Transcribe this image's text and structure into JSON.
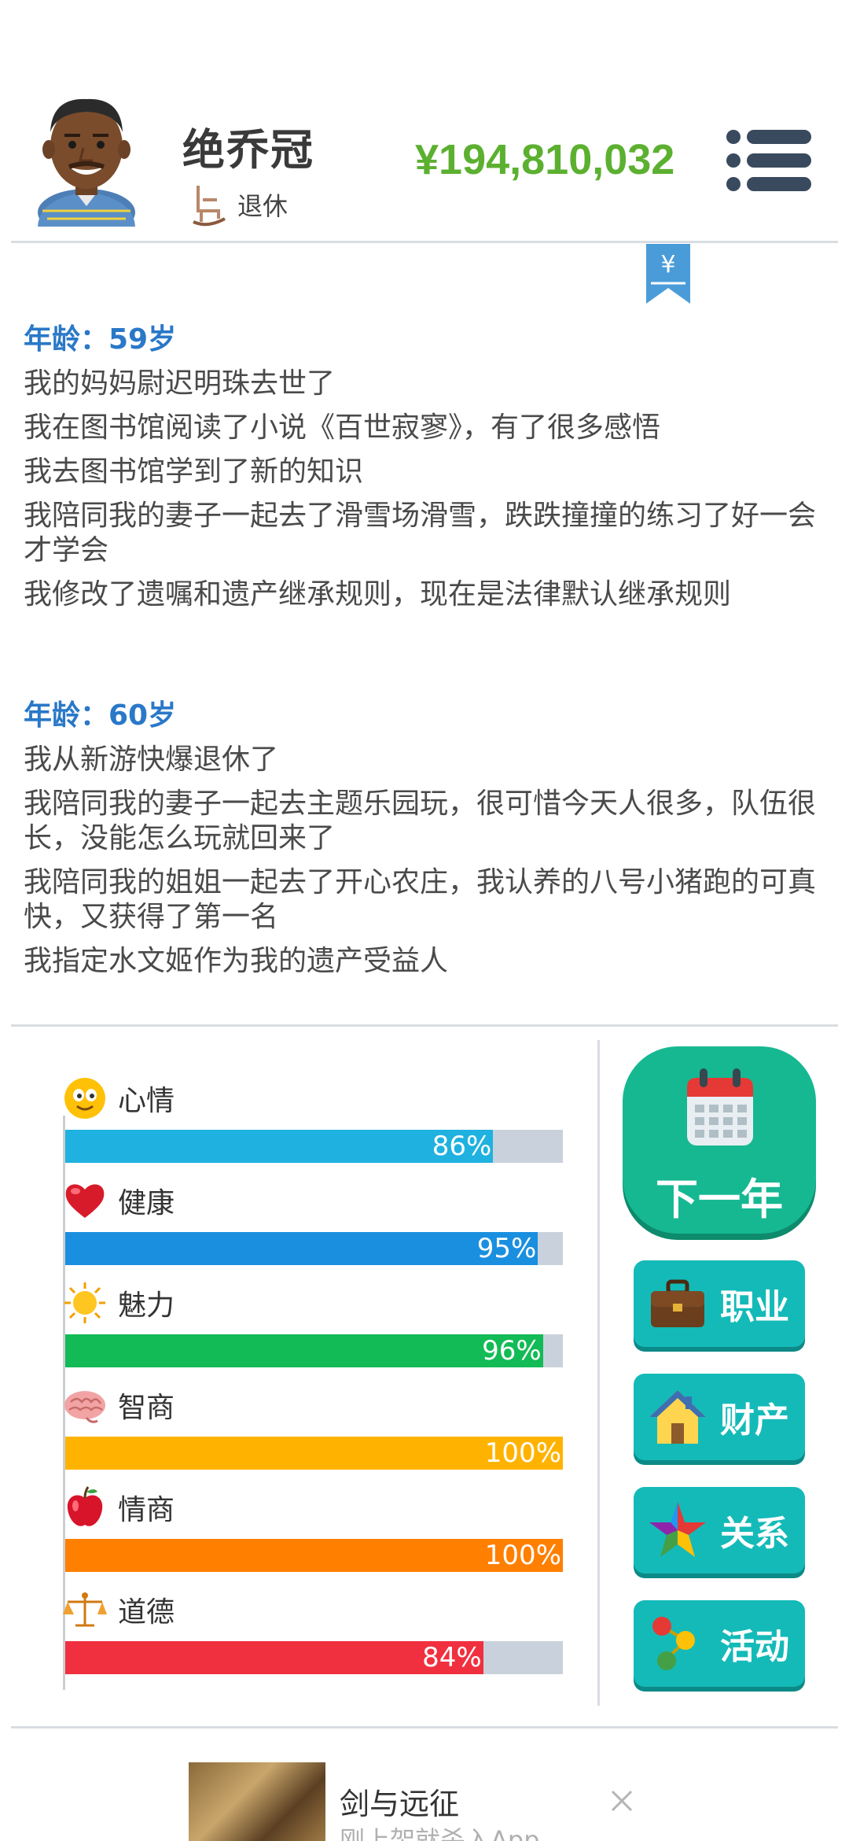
{
  "header": {
    "name": "绝乔冠",
    "status": "退休",
    "money": "¥194,810,032",
    "bookmark_symbol": "¥"
  },
  "log": [
    {
      "age_title": "年龄：59岁",
      "entries": [
        "我的妈妈尉迟明珠去世了",
        "我在图书馆阅读了小说《百世寂寥》，有了很多感悟",
        "我去图书馆学到了新的知识",
        "我陪同我的妻子一起去了滑雪场滑雪，跌跌撞撞的练习了好一会才学会",
        "我修改了遗嘱和遗产继承规则，现在是法律默认继承规则"
      ]
    },
    {
      "age_title": "年龄：60岁",
      "entries": [
        "我从新游快爆退休了",
        "我陪同我的妻子一起去主题乐园玩，很可惜今天人很多，队伍很长，没能怎么玩就回来了",
        "我陪同我的姐姐一起去了开心农庄，我认养的八号小猪跑的可真快，又获得了第一名",
        "我指定水文姬作为我的遗产受益人"
      ]
    }
  ],
  "stats": [
    {
      "label": "心情",
      "value": 86,
      "text": "86%",
      "color": "#1fb1df",
      "icon": "smiley-face-icon"
    },
    {
      "label": "健康",
      "value": 95,
      "text": "95%",
      "color": "#1a8fe0",
      "icon": "heart-icon"
    },
    {
      "label": "魅力",
      "value": 96,
      "text": "96%",
      "color": "#12bb55",
      "icon": "sun-icon"
    },
    {
      "label": "智商",
      "value": 100,
      "text": "100%",
      "color": "#ffb300",
      "icon": "brain-icon"
    },
    {
      "label": "情商",
      "value": 100,
      "text": "100%",
      "color": "#ff7f00",
      "icon": "apple-icon"
    },
    {
      "label": "道德",
      "value": 84,
      "text": "84%",
      "color": "#f0303f",
      "icon": "scales-icon"
    }
  ],
  "buttons": {
    "next_year": "下一年",
    "career": "职业",
    "property": "财产",
    "relations": "关系",
    "activities": "活动"
  },
  "ad": {
    "title": "剑与远征",
    "subtitle": "刚上架就杀入App ..."
  }
}
